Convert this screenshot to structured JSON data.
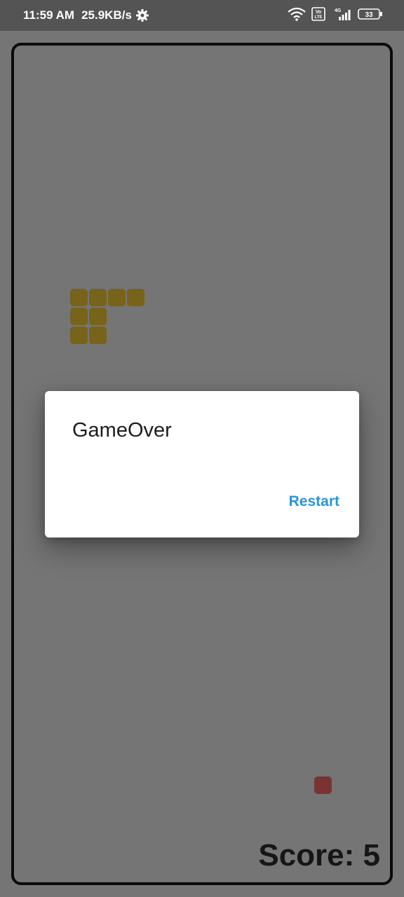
{
  "status_bar": {
    "time": "11:59 AM",
    "net_speed": "25.9KB/s",
    "battery": "33",
    "volte_label": "Vo LTE",
    "network_type": "4G",
    "icons": [
      "gear-icon",
      "wifi-icon",
      "volte-icon",
      "signal-icon",
      "battery-icon"
    ]
  },
  "game": {
    "score_text": "Score: 5",
    "snake_color": "#77631a",
    "food_color": "#7a3333"
  },
  "dialog": {
    "title": "GameOver",
    "button_label": "Restart",
    "button_color": "#2796d6"
  }
}
